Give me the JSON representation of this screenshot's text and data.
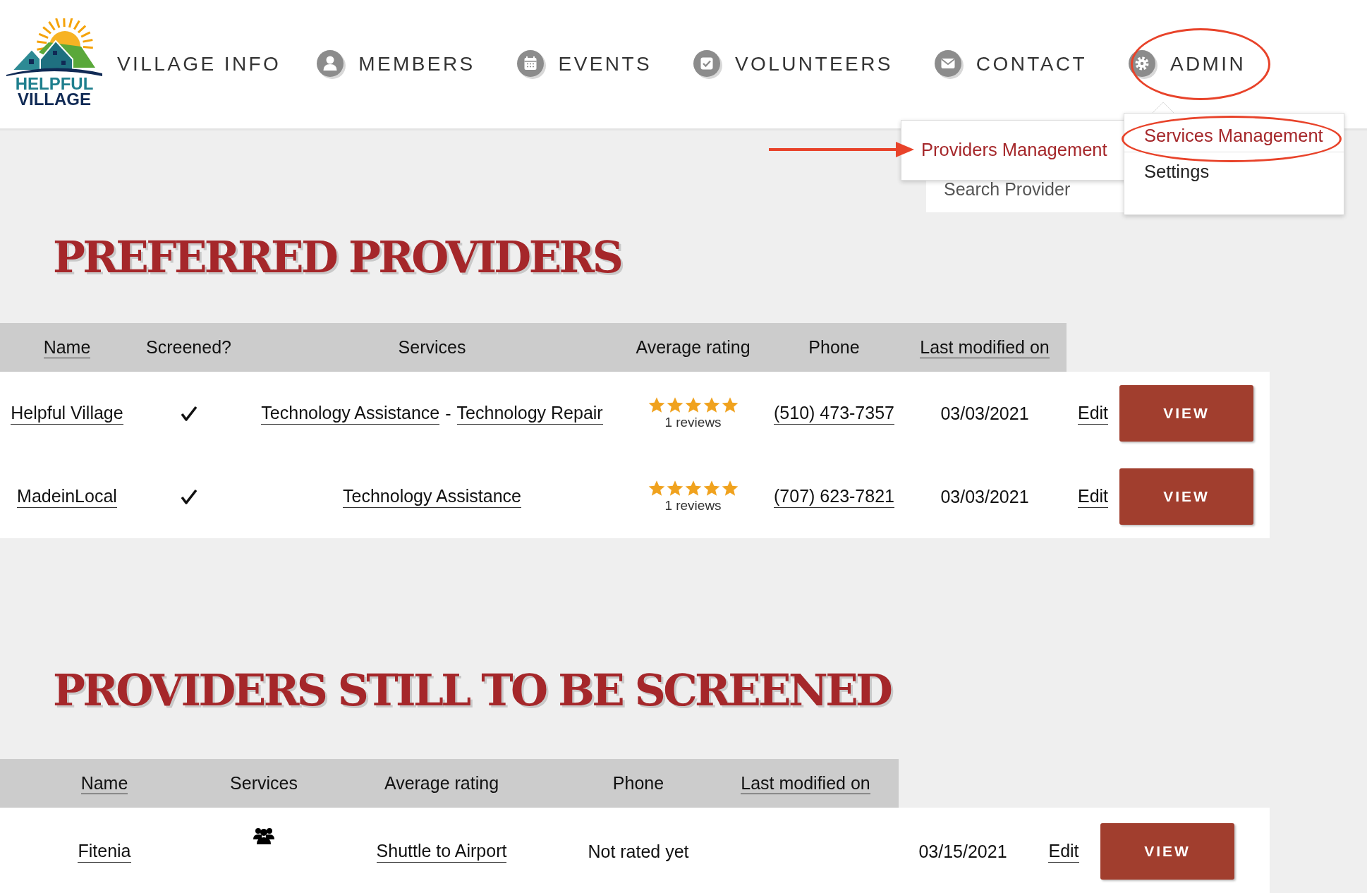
{
  "logo": {
    "lines": [
      "HELPFUL",
      "VILLAGE"
    ]
  },
  "nav": [
    {
      "label": "VILLAGE INFO"
    },
    {
      "label": "MEMBERS"
    },
    {
      "label": "EVENTS"
    },
    {
      "label": "VOLUNTEERS"
    },
    {
      "label": "CONTACT"
    },
    {
      "label": "ADMIN"
    }
  ],
  "admin_menu": {
    "submenu": [
      {
        "label": "Providers Management",
        "highlighted": true
      }
    ],
    "items": [
      {
        "label": "Services Management",
        "highlighted": true
      },
      {
        "label": "Settings",
        "highlighted": false
      }
    ]
  },
  "search": {
    "placeholder": "Search Provider"
  },
  "sections": [
    {
      "kind": "preferred",
      "title": "PREFERRED PROVIDERS",
      "separator": "-",
      "columns": [
        {
          "label": "Name",
          "sortable": true
        },
        {
          "label": "Screened?",
          "sortable": false
        },
        {
          "label": "Services",
          "sortable": false
        },
        {
          "label": "Average rating",
          "sortable": false
        },
        {
          "label": "Phone",
          "sortable": false
        },
        {
          "label": "Last modified on",
          "sortable": true
        }
      ],
      "rows": [
        {
          "name": "Helpful Village",
          "screened": true,
          "services": [
            "Technology Assistance",
            "Technology Repair"
          ],
          "stars": 5,
          "reviews": "1 reviews",
          "phone": "(510) 473-7357",
          "last_modified": "03/03/2021",
          "edit": "Edit",
          "view": "VIEW"
        },
        {
          "name": "MadeinLocal",
          "screened": true,
          "services": [
            "Technology Assistance"
          ],
          "stars": 5,
          "reviews": "1 reviews",
          "phone": "(707) 623-7821",
          "last_modified": "03/03/2021",
          "edit": "Edit",
          "view": "VIEW"
        }
      ]
    },
    {
      "kind": "screening",
      "title": "PROVIDERS STILL TO BE SCREENED",
      "columns": [
        {
          "label": "Name",
          "sortable": true
        },
        {
          "label": "Services",
          "sortable": false
        },
        {
          "label": "Average rating",
          "sortable": false
        },
        {
          "label": "Phone",
          "sortable": false
        },
        {
          "label": "Last modified on",
          "sortable": true
        }
      ],
      "rows": [
        {
          "name": "Fitenia",
          "services": [
            "Shuttle to Airport"
          ],
          "rating": "Not rated yet",
          "last_modified": "03/15/2021",
          "edit": "Edit",
          "view": "VIEW"
        }
      ]
    }
  ],
  "annotations": [
    {
      "kind": "ellipse"
    },
    {
      "kind": "ellipse"
    },
    {
      "kind": "arrow"
    }
  ]
}
